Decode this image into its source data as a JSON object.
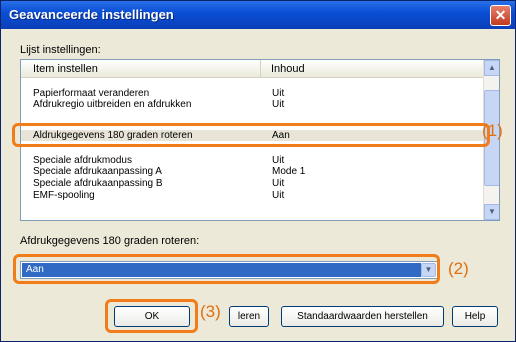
{
  "window": {
    "title": "Geavanceerde instellingen",
    "close_glyph": "✕"
  },
  "list": {
    "label": "Lijst instellingen:",
    "columns": [
      "Item instellen",
      "Inhoud"
    ],
    "top_partial": {
      "item": "",
      "value": ""
    },
    "rows": [
      {
        "item": "Papierformaat veranderen",
        "value": "Uit"
      },
      {
        "item": "Afdrukregio uitbreiden en afdrukken",
        "value": "Uit"
      },
      {
        "item": "Aldrukgegevens 180 graden roteren",
        "value": "Aan"
      },
      {
        "item": "Speciale afdrukmodus",
        "value": "Uit"
      },
      {
        "item": "Speciale afdrukaanpassing A",
        "value": "Mode 1"
      },
      {
        "item": "Speciale afdrukaanpassing B",
        "value": "Uit"
      },
      {
        "item": "EMF-spooling",
        "value": "Uit"
      }
    ],
    "selected_index": 2,
    "scroll_up_glyph": "▲",
    "scroll_down_glyph": "▼"
  },
  "setting": {
    "label": "Afdrukgegevens 180 graden roteren:",
    "value": "Aan",
    "dropdown_glyph": "▼"
  },
  "buttons": {
    "ok": "OK",
    "cancel_partial": "leren",
    "defaults": "Standaardwaarden herstellen",
    "help": "Help"
  },
  "callouts": [
    "(1)",
    "(2)",
    "(3)"
  ],
  "colors": {
    "accent": "#f07d1a",
    "titlebar": "#0a4fd6",
    "selection": "#316ac5"
  }
}
